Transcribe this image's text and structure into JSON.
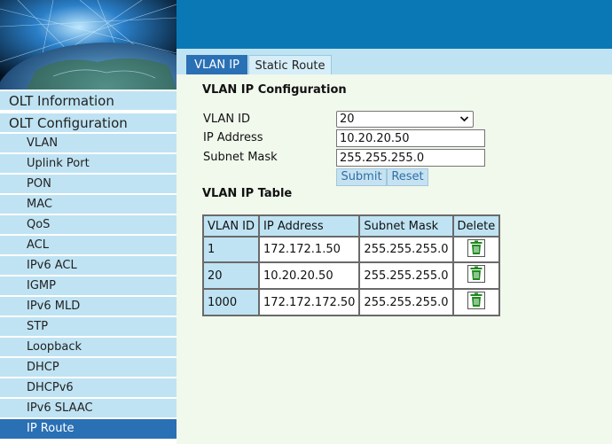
{
  "sidebar": {
    "sections": [
      "OLT Information",
      "OLT Configuration"
    ],
    "items": [
      "VLAN",
      "Uplink Port",
      "PON",
      "MAC",
      "QoS",
      "ACL",
      "IPv6 ACL",
      "IGMP",
      "IPv6 MLD",
      "STP",
      "Loopback",
      "DHCP",
      "DHCPv6",
      "IPv6 SLAAC",
      "IP Route"
    ],
    "active_item": "IP Route"
  },
  "tabs": [
    {
      "label": "VLAN IP",
      "active": true
    },
    {
      "label": "Static Route",
      "active": false
    }
  ],
  "config": {
    "title": "VLAN IP Configuration",
    "vlan_id_label": "VLAN ID",
    "vlan_id_value": "20",
    "ip_label": "IP Address",
    "ip_value": "10.20.20.50",
    "mask_label": "Subnet Mask",
    "mask_value": "255.255.255.0",
    "submit_label": "Submit",
    "reset_label": "Reset"
  },
  "table": {
    "title": "VLAN IP Table",
    "headers": [
      "VLAN ID",
      "IP Address",
      "Subnet Mask",
      "Delete"
    ],
    "rows": [
      {
        "vlan": "1",
        "ip": "172.172.1.50",
        "mask": "255.255.255.0",
        "delete_icon": "trash-icon"
      },
      {
        "vlan": "20",
        "ip": "10.20.20.50",
        "mask": "255.255.255.0",
        "delete_icon": "trash-icon"
      },
      {
        "vlan": "1000",
        "ip": "172.172.172.50",
        "mask": "255.255.255.0",
        "delete_icon": "trash-icon"
      }
    ]
  },
  "colors": {
    "topbar": "#0a78b5",
    "nav_bg": "#bfe3f3",
    "active": "#2a70b5",
    "content_bg": "#f1f8ec",
    "delete_icon": "#1f8a1f"
  }
}
